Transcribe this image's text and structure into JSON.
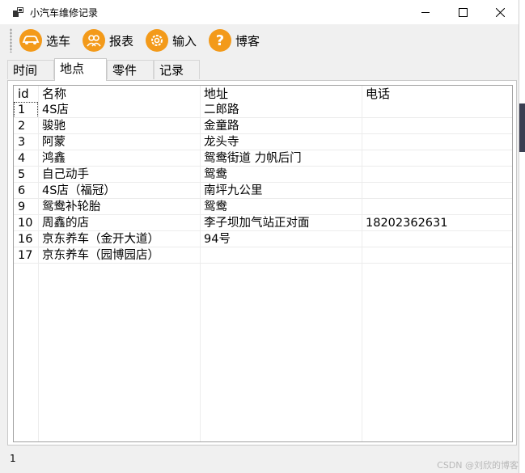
{
  "window": {
    "title": "小汽车维修记录"
  },
  "toolbar": {
    "buttons": [
      {
        "label": "选车",
        "icon": "car-icon"
      },
      {
        "label": "报表",
        "icon": "group-icon"
      },
      {
        "label": "输入",
        "icon": "gear-icon"
      },
      {
        "label": "博客",
        "icon": "help-icon"
      }
    ]
  },
  "tabs": [
    "时间",
    "地点",
    "零件",
    "记录"
  ],
  "active_tab": "地点",
  "table": {
    "columns": [
      "id",
      "名称",
      "地址",
      "电话"
    ],
    "rows": [
      [
        "1",
        "4S店",
        "二郎路",
        ""
      ],
      [
        "2",
        "骏驰",
        "金童路",
        ""
      ],
      [
        "3",
        "阿蒙",
        "龙头寺",
        ""
      ],
      [
        "4",
        "鸿鑫",
        "鸳鸯街道 力帆后门",
        ""
      ],
      [
        "5",
        "自己动手",
        "鸳鸯",
        ""
      ],
      [
        "6",
        "4S店（福冠）",
        "南坪九公里",
        ""
      ],
      [
        "9",
        "鸳鸯补轮胎",
        "鸳鸯",
        ""
      ],
      [
        "10",
        "周鑫的店",
        "李子坝加气站正对面",
        "18202362631"
      ],
      [
        "16",
        "京东养车（金开大道）",
        "94号",
        ""
      ],
      [
        "17",
        "京东养车（园博园店）",
        "",
        ""
      ]
    ]
  },
  "status": {
    "text": "1"
  },
  "watermark": "CSDN @刘欣的博客",
  "colors": {
    "toolbar_icon": "#f39a1a",
    "window_bg": "#f0f0f0"
  }
}
